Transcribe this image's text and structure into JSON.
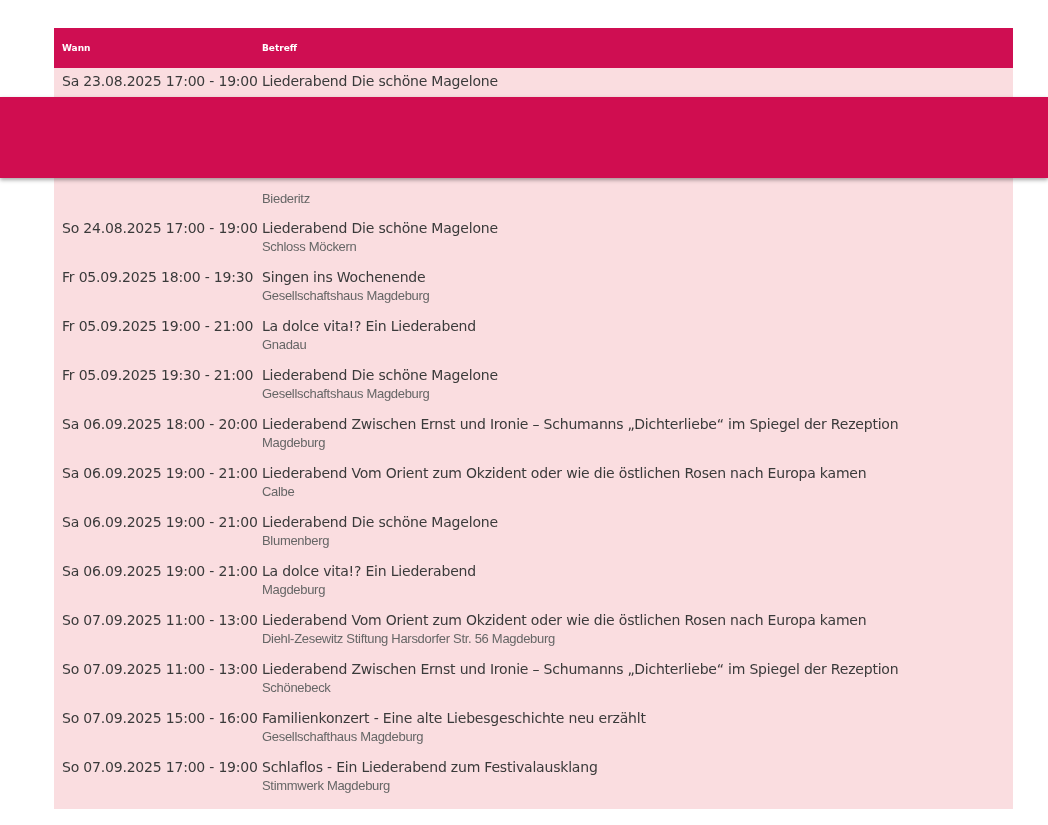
{
  "table": {
    "columns": [
      "Wann",
      "Betreff"
    ],
    "rows": [
      {
        "when": "Sa 23.08.2025 17:00 - 19:00",
        "title": "Liederabend Die schöne Magelone"
      },
      {
        "location": "Biederitz"
      },
      {
        "when": "So 24.08.2025 17:00 - 19:00",
        "title": "Liederabend Die schöne Magelone",
        "location": "Schloss Möckern"
      },
      {
        "when": "Fr 05.09.2025 18:00 - 19:30",
        "title": "Singen ins Wochenende",
        "location": "Gesellschaftshaus Magdeburg"
      },
      {
        "when": "Fr 05.09.2025 19:00 - 21:00",
        "title": "La dolce vita!? Ein Liederabend",
        "location": "Gnadau"
      },
      {
        "when": "Fr 05.09.2025 19:30 - 21:00",
        "title": "Liederabend Die schöne Magelone",
        "location": "Gesellschaftshaus Magdeburg"
      },
      {
        "when": "Sa 06.09.2025 18:00 - 20:00",
        "title": "Liederabend Zwischen Ernst und Ironie – Schumanns „Dichterliebe“ im Spiegel der Rezeption",
        "location": "Magdeburg"
      },
      {
        "when": "Sa 06.09.2025 19:00 - 21:00",
        "title": "Liederabend Vom Orient zum Okzident oder wie die östlichen Rosen nach Europa kamen",
        "location": "Calbe"
      },
      {
        "when": "Sa 06.09.2025 19:00 - 21:00",
        "title": "Liederabend Die schöne Magelone",
        "location": "Blumenberg"
      },
      {
        "when": "Sa 06.09.2025 19:00 - 21:00",
        "title": "La dolce vita!? Ein Liederabend",
        "location": "Magdeburg"
      },
      {
        "when": "So 07.09.2025 11:00 - 13:00",
        "title": "Liederabend Vom Orient zum Okzident oder wie die östlichen Rosen nach Europa kamen",
        "location": "Diehl-Zesewitz Stiftung Harsdorfer Str. 56 Magdeburg"
      },
      {
        "when": "So 07.09.2025 11:00 - 13:00",
        "title": "Liederabend Zwischen Ernst und Ironie – Schumanns „Dichterliebe“ im Spiegel der Rezeption",
        "location": "Schönebeck"
      },
      {
        "when": "So 07.09.2025 15:00 - 16:00",
        "title": "Familienkonzert - Eine alte Liebesgeschichte neu erzählt",
        "location": "Gesellschafthaus Magdeburg"
      },
      {
        "when": "So 07.09.2025 17:00 - 19:00",
        "title": "Schlaflos - Ein Liederabend zum Festivalausklang",
        "location": "Stimmwerk Magdeburg"
      }
    ]
  }
}
